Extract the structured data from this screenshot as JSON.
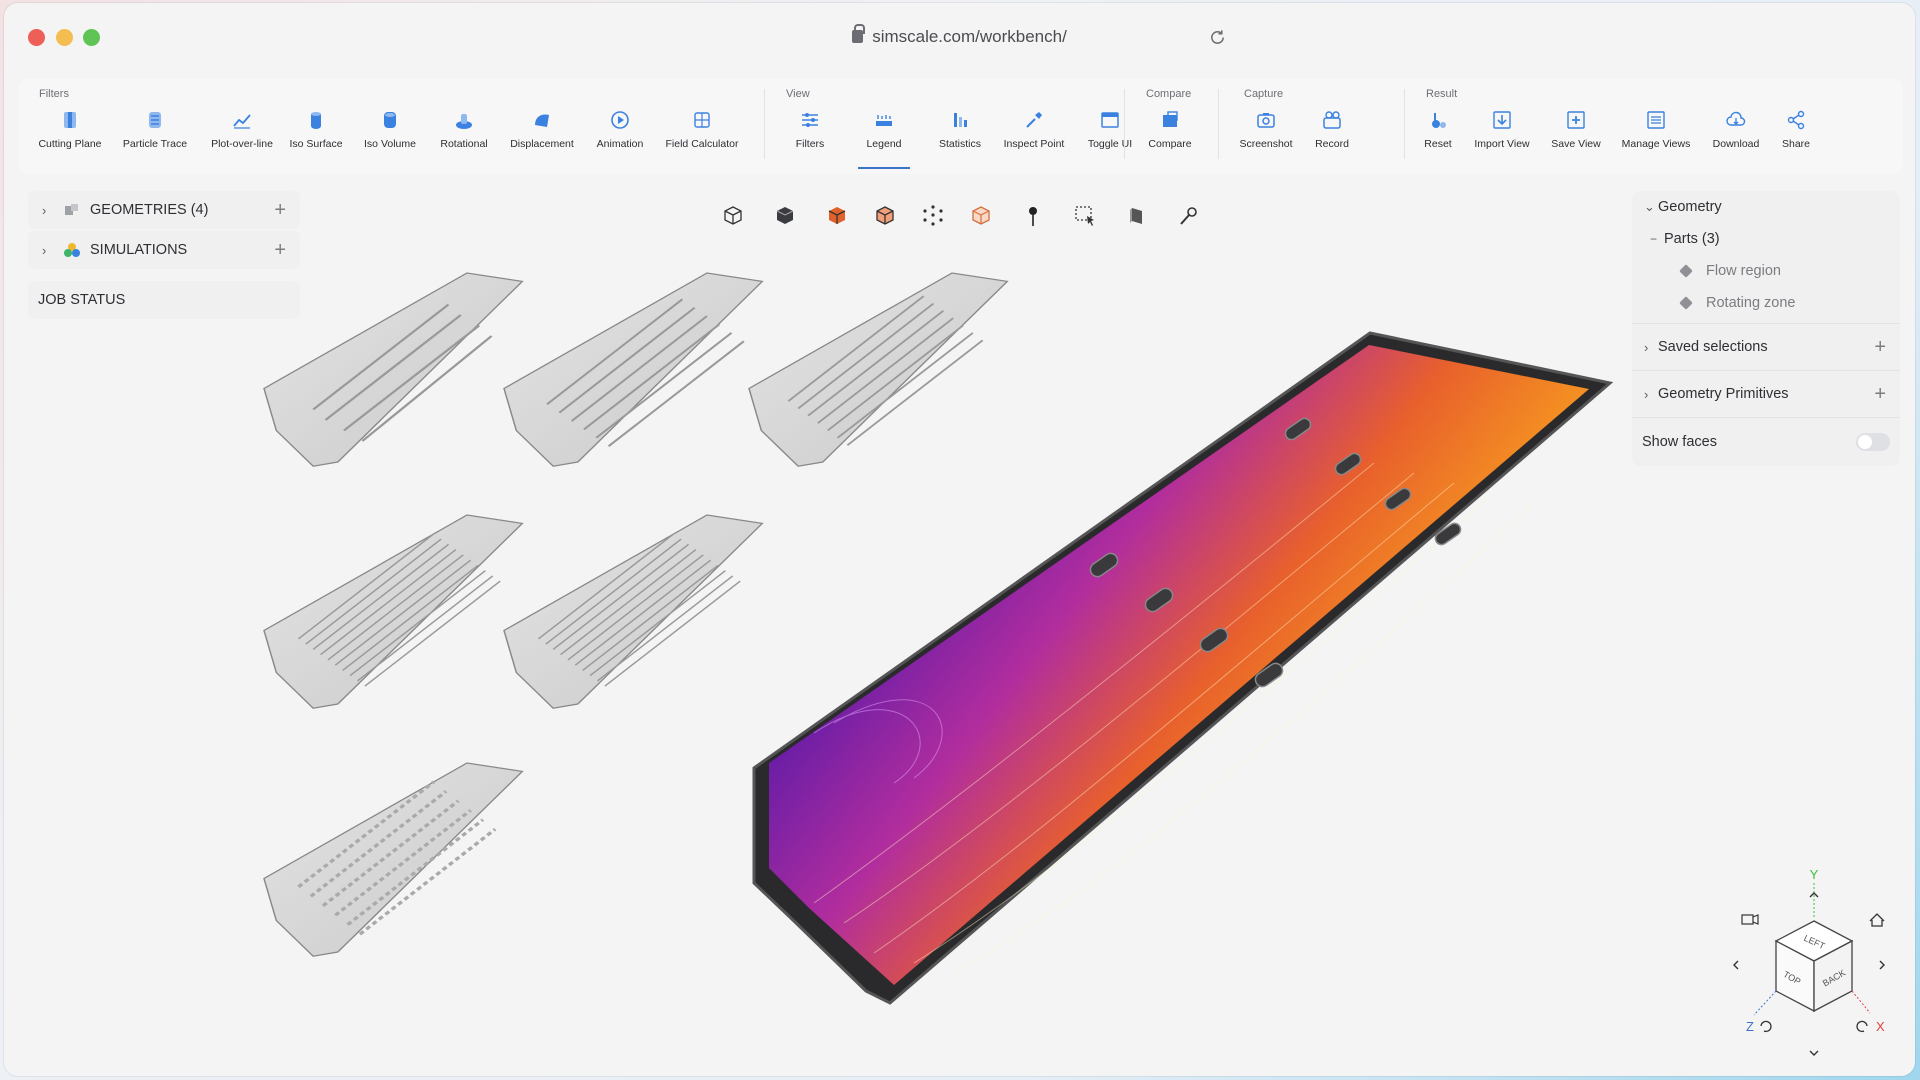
{
  "browser": {
    "url": "simscale.com/workbench/"
  },
  "toolbar": {
    "groups": [
      {
        "label": "Filters",
        "tools": [
          {
            "label": "Cutting Plane",
            "icon": "cutting-plane-icon"
          },
          {
            "label": "Particle Trace",
            "icon": "particle-trace-icon"
          },
          {
            "label": "Plot-over-line",
            "icon": "plot-over-line-icon"
          },
          {
            "label": "Iso Surface",
            "icon": "iso-surface-icon"
          },
          {
            "label": "Iso Volume",
            "icon": "iso-volume-icon"
          },
          {
            "label": "Rotational",
            "icon": "rotational-icon"
          },
          {
            "label": "Displacement",
            "icon": "displacement-icon"
          },
          {
            "label": "Animation",
            "icon": "animation-icon"
          },
          {
            "label": "Field Calculator",
            "icon": "field-calculator-icon"
          }
        ]
      },
      {
        "label": "View",
        "tools": [
          {
            "label": "Filters",
            "icon": "filters-icon"
          },
          {
            "label": "Legend",
            "icon": "legend-icon",
            "active": true
          },
          {
            "label": "Statistics",
            "icon": "statistics-icon"
          },
          {
            "label": "Inspect Point",
            "icon": "inspect-point-icon"
          },
          {
            "label": "Toggle UI",
            "icon": "toggle-ui-icon"
          }
        ]
      },
      {
        "label": "Compare",
        "tools": [
          {
            "label": "Compare",
            "icon": "compare-icon"
          }
        ]
      },
      {
        "label": "Capture",
        "tools": [
          {
            "label": "Screenshot",
            "icon": "screenshot-icon"
          },
          {
            "label": "Record",
            "icon": "record-icon"
          }
        ]
      },
      {
        "label": "Result",
        "tools": [
          {
            "label": "Reset",
            "icon": "reset-icon"
          },
          {
            "label": "Import View",
            "icon": "import-view-icon"
          },
          {
            "label": "Save View",
            "icon": "save-view-icon"
          },
          {
            "label": "Manage Views",
            "icon": "manage-views-icon"
          },
          {
            "label": "Download",
            "icon": "download-icon"
          },
          {
            "label": "Share",
            "icon": "share-icon"
          }
        ]
      }
    ]
  },
  "left_panel": {
    "geometries": "GEOMETRIES (4)",
    "simulations": "SIMULATIONS",
    "job_status": "JOB STATUS"
  },
  "right_panel": {
    "geometry": "Geometry",
    "parts": "Parts (3)",
    "part_items": [
      "Flow region",
      "Rotating zone"
    ],
    "saved_selections": "Saved selections",
    "geometry_primitives": "Geometry Primitives",
    "show_faces": "Show faces",
    "show_faces_on": false
  },
  "nav_cube": {
    "faces": [
      "LEFT",
      "TOP",
      "BACK"
    ],
    "axes": [
      "Y",
      "Z",
      "X"
    ]
  },
  "colors": {
    "accent": "#3a73c8",
    "icon_blue": "#3b82e0"
  }
}
